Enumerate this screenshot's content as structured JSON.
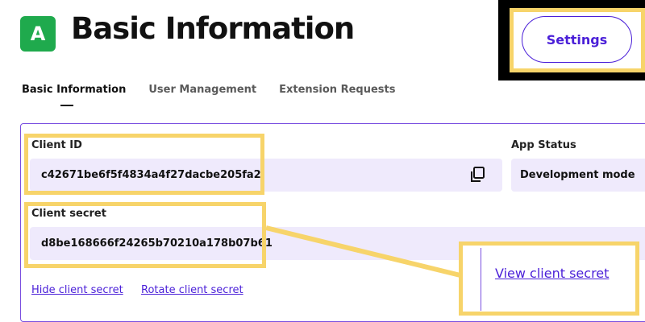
{
  "app": {
    "badge_letter": "A",
    "title": "Basic Information"
  },
  "header": {
    "settings_label": "Settings"
  },
  "tabs": [
    {
      "label": "Basic Information",
      "active": true
    },
    {
      "label": "User Management"
    },
    {
      "label": "Extension Requests"
    }
  ],
  "credentials": {
    "client_id_label": "Client ID",
    "client_id_value": "c42671be6f5f4834a4f27dacbe205fa2",
    "client_secret_label": "Client secret",
    "client_secret_value": "d8be168666f24265b70210a178b07b61",
    "hide_secret_link": "Hide client secret",
    "rotate_secret_link": "Rotate client secret"
  },
  "app_status": {
    "label": "App Status",
    "value": "Development mode"
  },
  "callout": {
    "link": "View client secret"
  },
  "colors": {
    "accent": "#4a1fd8",
    "highlight": "#f7d46a",
    "field_bg": "#efeafc",
    "badge": "#1faa4d"
  },
  "icons": {
    "copy": "copy-icon"
  }
}
